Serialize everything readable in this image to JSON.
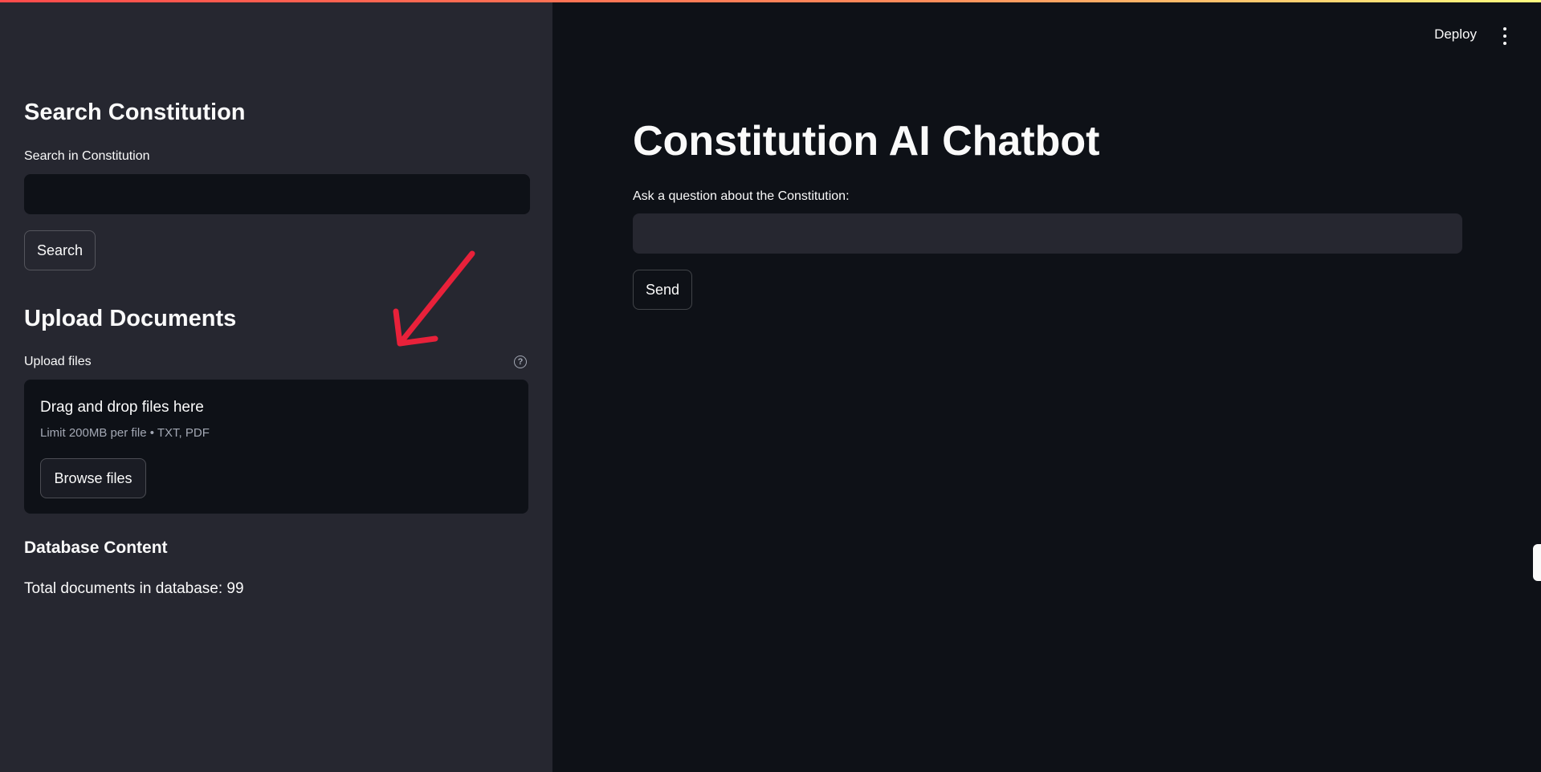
{
  "header": {
    "deploy_label": "Deploy"
  },
  "sidebar": {
    "search_section": {
      "heading": "Search Constitution",
      "input_label": "Search in Constitution",
      "input_value": "",
      "button_label": "Search"
    },
    "upload_section": {
      "heading": "Upload Documents",
      "uploader_label": "Upload files",
      "dropzone_title": "Drag and drop files here",
      "dropzone_subtitle": "Limit 200MB per file • TXT, PDF",
      "browse_button_label": "Browse files",
      "help_icon": "?"
    },
    "database_section": {
      "heading": "Database Content",
      "summary": "Total documents in database: 99"
    }
  },
  "main": {
    "title": "Constitution AI Chatbot",
    "question_label": "Ask a question about the Constitution:",
    "question_value": "",
    "send_button_label": "Send"
  },
  "colors": {
    "sidebar_bg": "#262730",
    "main_bg": "#0e1117",
    "text": "#fafafa",
    "muted": "#a3a8b4",
    "annotation_arrow": "#e8213a"
  },
  "icons": {
    "menu": "kebab-menu-icon",
    "help": "help-circle-icon",
    "annotation": "red-arrow-annotation"
  }
}
